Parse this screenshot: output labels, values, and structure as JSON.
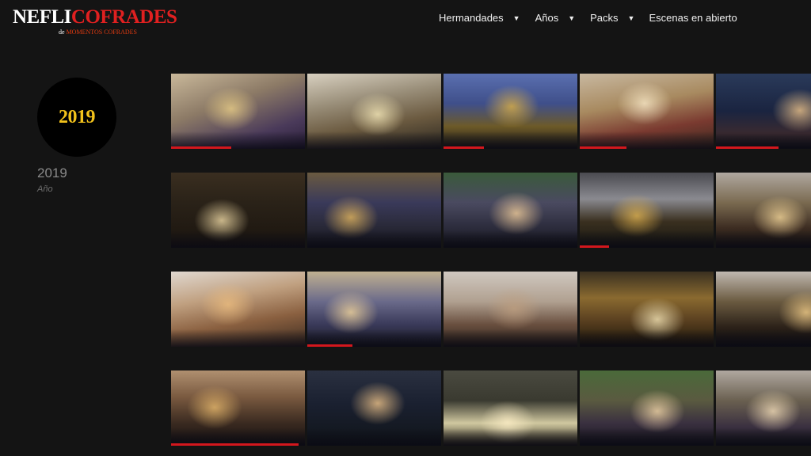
{
  "logo": {
    "part1": "NEFLI",
    "part2": "COFRADES",
    "sub_prefix": "de",
    "sub_brand": "MOMENTOS COFRADES"
  },
  "nav": {
    "items": [
      {
        "label": "Hermandades",
        "caret": "▼"
      },
      {
        "label": "Años",
        "caret": "▼"
      },
      {
        "label": "Packs",
        "caret": "▼"
      },
      {
        "label": "Escenas en abierto"
      }
    ]
  },
  "year_panel": {
    "badge": "2019",
    "title": "2019",
    "subtitle": "Año"
  },
  "colors": {
    "accent_red": "#d3171d",
    "badge_gold": "#f2c21b",
    "background": "#141414"
  },
  "thumbnails": {
    "rows": [
      [
        {
          "bg": "linear-gradient(160deg,#c9b89a 0%,#8c7a66 40%,#4a3a5a 75%,#2b1f3a 100%)",
          "glow": "#f0d48a",
          "progress": 0.45
        },
        {
          "bg": "linear-gradient(170deg,#d8d0c0 0%,#9a8f7a 35%,#6b5a40 65%,#2a261f 100%)",
          "glow": "#fff2c0",
          "progress": 0
        },
        {
          "bg": "linear-gradient(180deg,#5a6fb0 0%,#3f4f8a 40%,#6d5a28 70%,#1c1a18 100%)",
          "glow": "#e8b840",
          "progress": 0.3
        },
        {
          "bg": "linear-gradient(170deg,#c8b8a0 0%,#a88a60 40%,#7a3a30 70%,#3a2a20 100%)",
          "glow": "#fff0d0",
          "progress": 0.35
        },
        {
          "bg": "linear-gradient(180deg,#2a3a5a 0%,#1a2440 50%,#3a2a30 80%,#141418 100%)",
          "glow": "#ffd090",
          "progress": 0.47
        }
      ],
      [
        {
          "bg": "linear-gradient(180deg,#3a2e20 0%,#2a2218 40%,#1a140e 100%)",
          "glow": "#ffe8b0",
          "progress": 0
        },
        {
          "bg": "linear-gradient(180deg,#6a5a40 0%,#3a3a5a 40%,#2a2a3a 70%,#14141a 100%)",
          "glow": "#f0c060",
          "progress": 0
        },
        {
          "bg": "linear-gradient(180deg,#3a5a3a 0%,#4a4a60 40%,#2a2a3a 75%,#141418 100%)",
          "glow": "#ffd8a0",
          "progress": 0
        },
        {
          "bg": "linear-gradient(180deg,#4a4a50 0%,#8a8a90 35%,#3a3020 65%,#14140f 100%)",
          "glow": "#e8b850",
          "progress": 0.22
        },
        {
          "bg": "linear-gradient(180deg,#b0a8a0 0%,#7a6a50 40%,#3a2a20 75%,#181410 100%)",
          "glow": "#ffe0a0",
          "progress": 0
        }
      ],
      [
        {
          "bg": "linear-gradient(170deg,#e0d8d0 0%,#c0a080 35%,#8a6040 65%,#3a2a20 100%)",
          "glow": "#f0c080",
          "progress": 0
        },
        {
          "bg": "linear-gradient(180deg,#c0b090 0%,#6a6a8a 40%,#3a3a5a 70%,#181820 100%)",
          "glow": "#ffe0a0",
          "progress": 0.34
        },
        {
          "bg": "linear-gradient(180deg,#d0c8c0 0%,#b0a090 40%,#6a5040 70%,#2a2018 100%)",
          "glow": "#c0a080",
          "progress": 0
        },
        {
          "bg": "linear-gradient(180deg,#3a3020 0%,#8a6a30 35%,#5a4020 65%,#1a1408 100%)",
          "glow": "#fff0c0",
          "progress": 0
        },
        {
          "bg": "linear-gradient(180deg,#c0b8b0 0%,#6a5a40 40%,#2a2018 75%,#121010 100%)",
          "glow": "#ffd890",
          "progress": 0
        }
      ],
      [
        {
          "bg": "linear-gradient(180deg,#b09070 0%,#7a5a40 35%,#3a2a20 70%,#141010 100%)",
          "glow": "#f0c070",
          "progress": 0.95
        },
        {
          "bg": "linear-gradient(180deg,#2a3040 0%,#1a2030 45%,#101418 100%)",
          "glow": "#ffd090",
          "progress": 0
        },
        {
          "bg": "linear-gradient(180deg,#4a4a40 0%,#3a3a30 40%,#d0c8a0 70%,#2a2418 100%)",
          "glow": "#fff0c8",
          "progress": 0
        },
        {
          "bg": "linear-gradient(180deg,#4a6a3a 0%,#5a5a40 40%,#3a3040 70%,#14141a 100%)",
          "glow": "#ffe0b0",
          "progress": 0
        },
        {
          "bg": "linear-gradient(180deg,#b0a8a0 0%,#6a6050 40%,#3a3040 75%,#141418 100%)",
          "glow": "#ffe8c0",
          "progress": 0
        }
      ]
    ]
  }
}
